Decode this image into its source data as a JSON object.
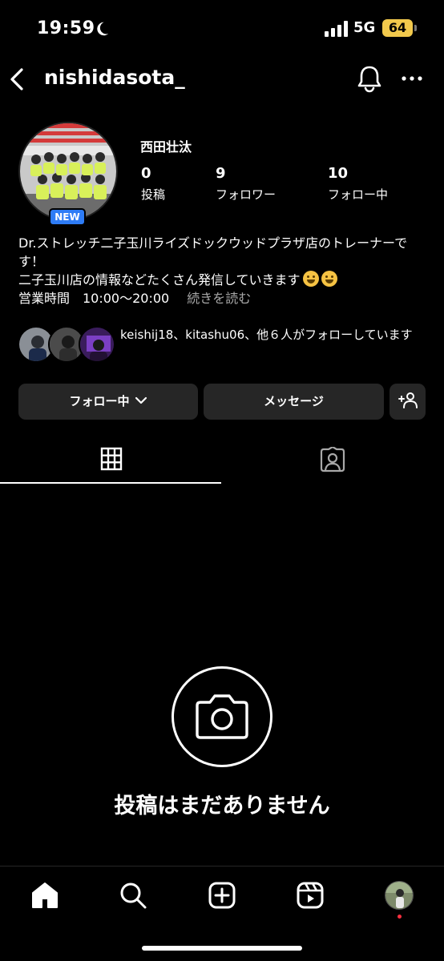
{
  "status_bar": {
    "time": "19:59",
    "network": "5G",
    "battery": "64"
  },
  "header": {
    "username": "nishidasota_"
  },
  "profile": {
    "badge": "NEW",
    "display_name": "西田壮汰",
    "stats": [
      {
        "value": "0",
        "label": "投稿"
      },
      {
        "value": "9",
        "label": "フォロワー"
      },
      {
        "value": "10",
        "label": "フォロー中"
      }
    ],
    "bio_lines": [
      "Dr.ストレッチ二子玉川ライズドックウッドプラザ店のトレーナーで",
      "す！",
      "二子玉川店の情報などたくさん発信していきます",
      "営業時間　10:00〜20:00"
    ],
    "more_link": "続きを読む",
    "followed_by": "keishij18、kitashu06、他６人がフォローしています"
  },
  "actions": {
    "following": "フォロー中",
    "message": "メッセージ"
  },
  "empty_state": {
    "text": "投稿はまだありません"
  },
  "icons": {
    "back": "back-icon",
    "bell": "bell-icon",
    "more": "more-icon",
    "grid": "grid-icon",
    "tagged": "tagged-icon",
    "camera": "camera-icon",
    "home": "home-icon",
    "search": "search-icon",
    "create": "create-icon",
    "reels": "reels-icon",
    "add_person": "add-person-icon"
  },
  "colors": {
    "background": "#000000",
    "button": "#262626",
    "badge": "#2e7cf6",
    "battery": "#f2c94c",
    "secondary_text": "#a8a8a8",
    "notification_dot": "#ff3040"
  }
}
